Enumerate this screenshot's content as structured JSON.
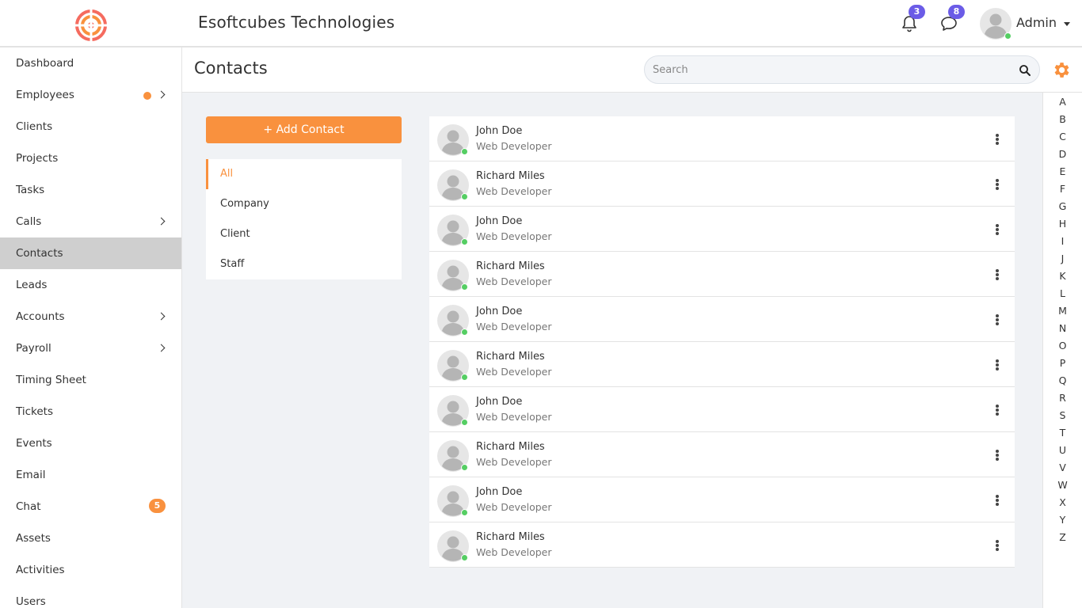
{
  "header": {
    "company": "Esoftcubes Technologies",
    "notifications_count": "3",
    "messages_count": "8",
    "user_name": "Admin"
  },
  "sidebar": {
    "items": [
      {
        "label": "Dashboard",
        "name": "dashboard"
      },
      {
        "label": "Employees",
        "name": "employees"
      },
      {
        "label": "Clients",
        "name": "clients"
      },
      {
        "label": "Projects",
        "name": "projects"
      },
      {
        "label": "Tasks",
        "name": "tasks"
      },
      {
        "label": "Calls",
        "name": "calls"
      },
      {
        "label": "Contacts",
        "name": "contacts"
      },
      {
        "label": "Leads",
        "name": "leads"
      },
      {
        "label": "Accounts",
        "name": "accounts"
      },
      {
        "label": "Payroll",
        "name": "payroll"
      },
      {
        "label": "Timing Sheet",
        "name": "timing-sheet"
      },
      {
        "label": "Tickets",
        "name": "tickets"
      },
      {
        "label": "Events",
        "name": "events"
      },
      {
        "label": "Email",
        "name": "email"
      },
      {
        "label": "Chat",
        "name": "chat",
        "count": "5"
      },
      {
        "label": "Assets",
        "name": "assets"
      },
      {
        "label": "Activities",
        "name": "activities"
      },
      {
        "label": "Users",
        "name": "users"
      }
    ]
  },
  "page": {
    "title": "Contacts",
    "search_placeholder": "Search"
  },
  "filters": {
    "add_label": "+ Add Contact",
    "items": [
      "All",
      "Company",
      "Client",
      "Staff"
    ]
  },
  "contacts": [
    {
      "name": "John Doe",
      "role": "Web Developer"
    },
    {
      "name": "Richard Miles",
      "role": "Web Developer"
    },
    {
      "name": "John Doe",
      "role": "Web Developer"
    },
    {
      "name": "Richard Miles",
      "role": "Web Developer"
    },
    {
      "name": "John Doe",
      "role": "Web Developer"
    },
    {
      "name": "Richard Miles",
      "role": "Web Developer"
    },
    {
      "name": "John Doe",
      "role": "Web Developer"
    },
    {
      "name": "Richard Miles",
      "role": "Web Developer"
    },
    {
      "name": "John Doe",
      "role": "Web Developer"
    },
    {
      "name": "Richard Miles",
      "role": "Web Developer"
    }
  ],
  "alphabet": [
    "A",
    "B",
    "C",
    "D",
    "E",
    "F",
    "G",
    "H",
    "I",
    "J",
    "K",
    "L",
    "M",
    "N",
    "O",
    "P",
    "Q",
    "R",
    "S",
    "T",
    "U",
    "V",
    "W",
    "X",
    "Y",
    "Z"
  ],
  "colors": {
    "accent": "#f9913e",
    "badge": "#6b5ce7",
    "online": "#55ce63",
    "active_nav": "#cfcfcf"
  }
}
